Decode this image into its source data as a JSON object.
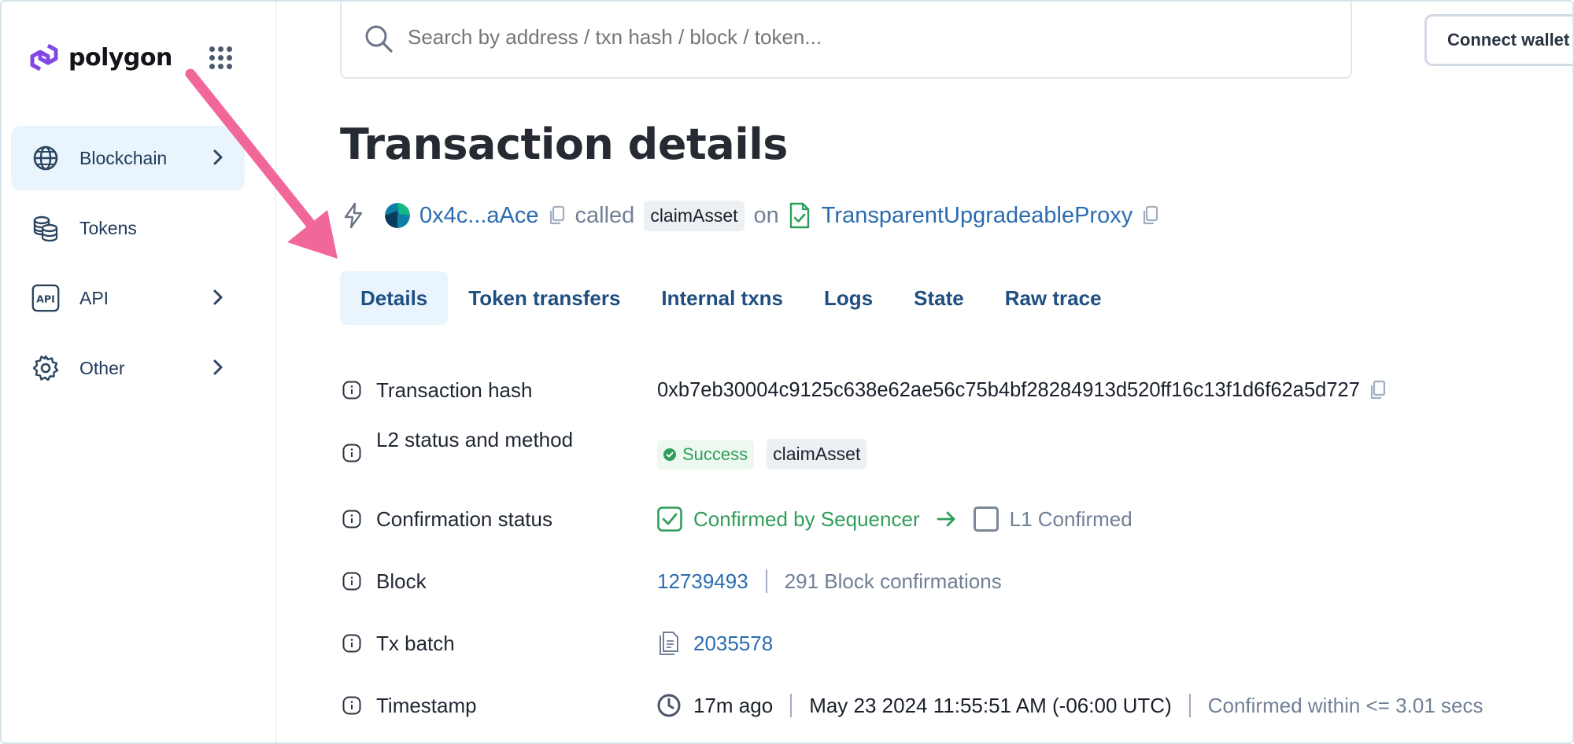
{
  "brand": {
    "name": "polygon"
  },
  "sidebar": {
    "items": [
      {
        "label": "Blockchain",
        "icon": "globe-icon",
        "active": true,
        "has_chevron": true
      },
      {
        "label": "Tokens",
        "icon": "coins-icon",
        "active": false,
        "has_chevron": false
      },
      {
        "label": "API",
        "icon": "api-icon",
        "active": false,
        "has_chevron": true
      },
      {
        "label": "Other",
        "icon": "gear-icon",
        "active": false,
        "has_chevron": true
      }
    ]
  },
  "header": {
    "search_placeholder": "Search by address / txn hash / block / token...",
    "connect_label": "Connect wallet"
  },
  "page": {
    "title": "Transaction details",
    "call": {
      "from_address": "0x4c...aAce",
      "called_word": "called",
      "method": "claimAsset",
      "on_word": "on",
      "contract": "TransparentUpgradeableProxy"
    },
    "tabs": [
      {
        "label": "Details",
        "active": true
      },
      {
        "label": "Token transfers",
        "active": false
      },
      {
        "label": "Internal txns",
        "active": false
      },
      {
        "label": "Logs",
        "active": false
      },
      {
        "label": "State",
        "active": false
      },
      {
        "label": "Raw trace",
        "active": false
      }
    ]
  },
  "details": {
    "tx_hash": {
      "label": "Transaction hash",
      "value": "0xb7eb30004c9125c638e62ae56c75b4bf28284913d520ff16c13f1d6f62a5d727"
    },
    "status": {
      "label": "L2 status and method",
      "status": "Success",
      "method": "claimAsset"
    },
    "confirmation": {
      "label": "Confirmation status",
      "step1": "Confirmed by Sequencer",
      "step2": "L1 Confirmed"
    },
    "block": {
      "label": "Block",
      "number": "12739493",
      "confirmations": "291 Block confirmations"
    },
    "batch": {
      "label": "Tx batch",
      "value": "2035578"
    },
    "timestamp": {
      "label": "Timestamp",
      "relative": "17m ago",
      "absolute": "May 23 2024 11:55:51 AM (-06:00 UTC)",
      "confirmed_within": "Confirmed within <= 3.01 secs"
    }
  },
  "colors": {
    "accent_blue": "#2b6cb0",
    "success_green": "#2f9e5a",
    "active_bg": "#e9f4fc",
    "annotation_pink": "#f2679a",
    "polygon_purple": "#8247e5"
  }
}
